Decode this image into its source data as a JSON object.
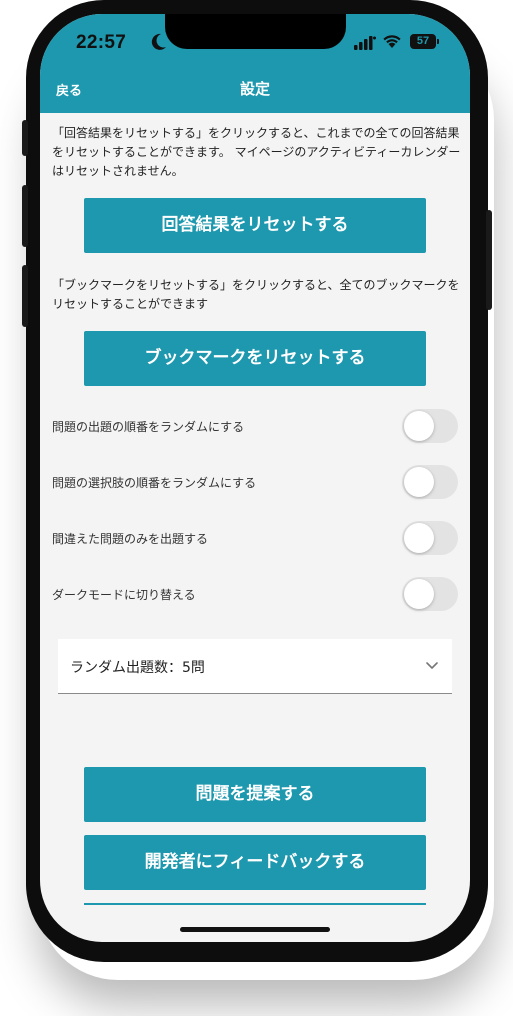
{
  "status_bar": {
    "time": "22:57",
    "battery": "57"
  },
  "header": {
    "back_label": "戻る",
    "title": "設定"
  },
  "reset_answers": {
    "description": "「回答結果をリセットする」をクリックすると、これまでの全ての回答結果をリセットすることができます。 マイページのアクティビティーカレンダーはリセットされません。",
    "button_label": "回答結果をリセットする"
  },
  "reset_bookmarks": {
    "description": "「ブックマークをリセットする」をクリックすると、全てのブックマークをリセットすることができます",
    "button_label": "ブックマークをリセットする"
  },
  "settings": [
    {
      "label": "問題の出題の順番をランダムにする",
      "enabled": false
    },
    {
      "label": "問題の選択肢の順番をランダムにする",
      "enabled": false
    },
    {
      "label": "間違えた問題のみを出題する",
      "enabled": false
    },
    {
      "label": "ダークモードに切り替える",
      "enabled": false
    }
  ],
  "random_count_select": {
    "value": "ランダム出題数：5問"
  },
  "buttons": {
    "suggest_question": "問題を提案する",
    "feedback": "開発者にフィードバックする"
  },
  "colors": {
    "accent": "#1d98ae",
    "background": "#f4f4f4",
    "toggle_off": "#e3e3e3"
  }
}
